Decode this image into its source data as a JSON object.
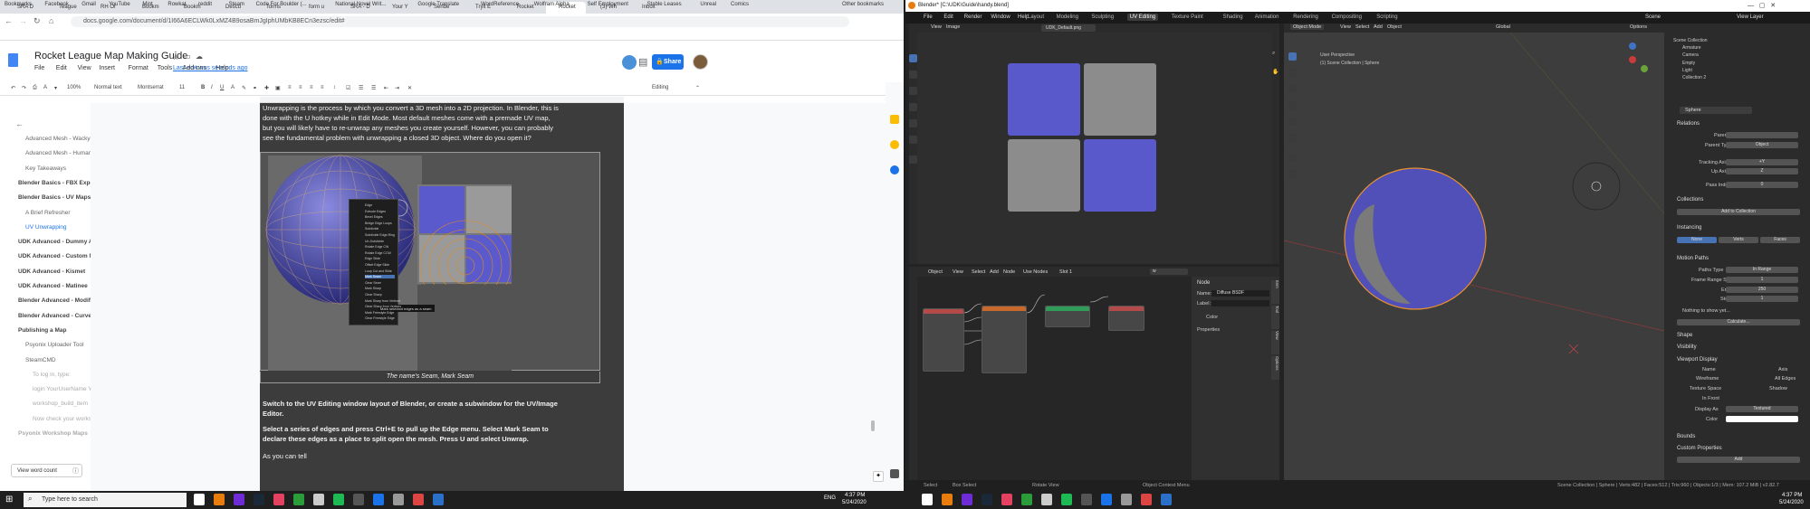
{
  "chrome": {
    "tabs": [
      "SRA D",
      "Teague",
      "RH Or",
      "Bookm",
      "Bookm",
      "Descu",
      "forms",
      "form u",
      "SRA - D",
      "Your Y",
      "Sende",
      "Tryit E",
      "Rocket",
      "Rocket",
      "(3) Wh",
      "Inbox"
    ],
    "url": "docs.google.com/document/d/1I66A6ECLWk0LxMZ4B9osaBmJgIphUMbKB8ECn3ezsc/edit#",
    "bookmarks": [
      "Bookmarks",
      "Facebook",
      "Gmail",
      "YouTube",
      "Mint",
      "Rowkat",
      "reddit",
      "Steam",
      "Code For Boulder (...",
      "National Novel Writ...",
      "Google Translate",
      "WordReference",
      "Wolfram Alpha",
      "Self Employment",
      "Stable Leases",
      "Unreal",
      "Comics",
      "Other bookmarks"
    ]
  },
  "docs": {
    "title": "Rocket League Map Making Guide",
    "menus": [
      "File",
      "Edit",
      "View",
      "Insert",
      "Format",
      "Tools",
      "Add-ons",
      "Help"
    ],
    "last_edit": "Last edit was seconds ago",
    "share": "Share",
    "toolbar": {
      "zoom": "100%",
      "style": "Normal text",
      "font": "Montserrat",
      "size": "11",
      "mode": "Editing"
    },
    "outline": [
      {
        "text": "Advanced Mesh - Wacky Skatep...",
        "level": 2
      },
      {
        "text": "Advanced Mesh - Human Hand",
        "level": 2
      },
      {
        "text": "Key Takeaways",
        "level": 2
      },
      {
        "text": "Blender Basics - FBX Export",
        "level": 1
      },
      {
        "text": "Blender Basics - UV Maps an...",
        "level": 1
      },
      {
        "text": "A Brief Refresher",
        "level": 2
      },
      {
        "text": "UV Unwrapping",
        "level": 2,
        "active": true
      },
      {
        "text": "UDK Advanced - Dummy Ass...",
        "level": 1
      },
      {
        "text": "UDK Advanced - Custom Mat...",
        "level": 1
      },
      {
        "text": "UDK Advanced - Kismet",
        "level": 1
      },
      {
        "text": "UDK Advanced - Matinee",
        "level": 1
      },
      {
        "text": "Blender Advanced - Modifiers",
        "level": 1
      },
      {
        "text": "Blender Advanced - Curves",
        "level": 1
      },
      {
        "text": "Publishing a Map",
        "level": 1
      },
      {
        "text": "Psyonix Uploader Tool",
        "level": 2
      },
      {
        "text": "SteamCMD",
        "level": 2
      },
      {
        "text": "To log in, type:",
        "level": 3
      },
      {
        "text": "login YourUserName YourPa...",
        "level": 3
      },
      {
        "text": "workshop_build_item",
        "level": 3
      },
      {
        "text": "Now check your workshop a...",
        "level": 3
      },
      {
        "text": "Psyonix Workshop Maps",
        "level": 1
      }
    ],
    "word_count": "View word count",
    "body": [
      "Unwrapping is the process by which you convert a 3D mesh into a 2D projection. In Blender, this is",
      "done with the U hotkey while in Edit Mode. Most default meshes come with a premade UV map,",
      "but you will likely have to re-unwrap any meshes you create yourself. However, you can probably",
      "see the fundamental problem with unwrapping a closed 3D object. Where do you open it?"
    ],
    "caption": "The name's Seam, Mark Seam",
    "para2": [
      "Switch to the UV Editing window layout of Blender, or create a subwindow for the UV/Image",
      "Editor."
    ],
    "para3": [
      "Select a series of edges and press Ctrl+E to pull up the Edge menu. Select Mark Seam to",
      "declare these edges as a place to split open the mesh. Press U and select Unwrap."
    ],
    "para4": "As you can tell",
    "context_menu": [
      "Edge",
      "Extrude Edges",
      "Bevel Edges",
      "Bridge Edge Loops",
      "Subdivide",
      "Subdivide Edge-Ring",
      "Un-Subdivide",
      "Rotate Edge CW",
      "Rotate Edge CCW",
      "Edge Slide",
      "Offset Edge Slide",
      "Loop Cut and Slide",
      "Mark Seam",
      "Clear Seam",
      "Mark Sharp",
      "Clear Sharp",
      "Mark Sharp from Vertices",
      "Clear Sharp from Vertices",
      "Mark Freestyle Edge",
      "Clear Freestyle Edge"
    ],
    "tooltip": "Mark selected edges as a seam"
  },
  "taskbar": {
    "search": "Type here to search",
    "time1": "4:37 PM",
    "date1": "5/24/2020",
    "time2": "4:37 PM",
    "date2": "5/24/2020",
    "lang": "ENG"
  },
  "blender": {
    "title": "Blender* [C:\\UDK\\Guide\\handy.blend]",
    "menus": [
      "File",
      "Edit",
      "Render",
      "Window",
      "Help"
    ],
    "workspaces": [
      "Layout",
      "Modeling",
      "Sculpting",
      "UV Editing",
      "Texture Paint",
      "Shading",
      "Animation",
      "Rendering",
      "Compositing",
      "Scripting"
    ],
    "active_ws": "UV Editing",
    "scene": "Scene",
    "view_layer": "View Layer",
    "uv_header": [
      "View",
      "Image"
    ],
    "uv_image": "UDK_Default.png",
    "node_header": [
      "Object",
      "View",
      "Select",
      "Add",
      "Node",
      "Use Nodes",
      "Slot 1"
    ],
    "node_search": "w",
    "node_panel": {
      "section": "Node",
      "name_label": "Name:",
      "name": "Diffuse BSDF",
      "label_label": "Label:",
      "color": "Color",
      "properties": "Properties"
    },
    "node_tabs": [
      "Item",
      "Tool",
      "View",
      "Options"
    ],
    "vp_header": [
      "Object Mode",
      "View",
      "Select",
      "Add",
      "Object"
    ],
    "vp_info1": "User Perspective",
    "vp_info2": "(1) Scene Collection | Sphere",
    "global": "Global",
    "options": "Options",
    "outliner": [
      "Scene Collection",
      "Armature",
      "Camera",
      "Empty",
      "Light",
      "Collection 2"
    ],
    "obj_name": "Sphere",
    "props": {
      "relations": "Relations",
      "parent": "Parent",
      "parent_type": "Parent Type",
      "parent_type_val": "Object",
      "tracking_axis": "Tracking Axis",
      "tracking_val": "+Y",
      "up_axis": "Up Axis",
      "up_val": "Z",
      "pass_index": "Pass Index",
      "pass_val": "0",
      "collections": "Collections",
      "add_collection": "Add to Collection",
      "instancing": "Instancing",
      "inst_opts": [
        "None",
        "Verts",
        "Faces"
      ],
      "motion_paths": "Motion Paths",
      "paths_type": "Paths Type",
      "paths_type_val": "In Range",
      "frame_start": "Frame Range Start",
      "frame_start_val": "1",
      "end": "End",
      "end_val": "250",
      "step": "Step",
      "step_val": "1",
      "nothing": "Nothing to show yet...",
      "calculate": "Calculate...",
      "shape": "Shape",
      "visibility": "Visibility",
      "viewport_display": "Viewport Display",
      "name": "Name",
      "axis": "Axis",
      "wireframe": "Wireframe",
      "all_edges": "All Edges",
      "texture_space": "Texture Space",
      "shadow": "Shadow",
      "in_front": "In Front",
      "display_as": "Display As",
      "display_val": "Textured",
      "color": "Color",
      "bounds": "Bounds",
      "custom_props": "Custom Properties",
      "add": "Add"
    },
    "status": {
      "select": "Select",
      "box": "Box Select",
      "rotate": "Rotate View",
      "ctx": "Object Context Menu",
      "info": "Scene Collection | Sphere | Verts:482 | Faces:512 | Tris:960 | Objects:1/3 | Mem: 107.2 MiB | v2.82.7"
    },
    "uv_colors": {
      "blue": "#5959cc",
      "grey": "#8c8c8c"
    }
  }
}
